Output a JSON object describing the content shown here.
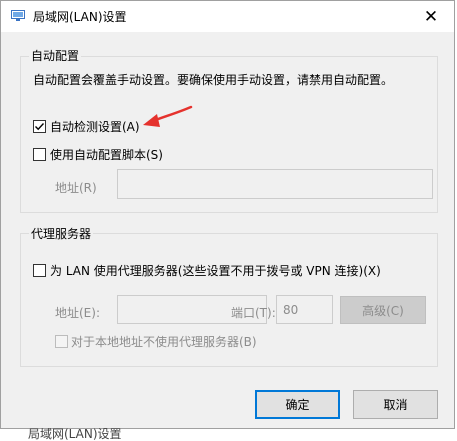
{
  "window": {
    "title": "局域网(LAN)设置",
    "close_glyph": "✕",
    "background_title": "局域网(LAN)设置"
  },
  "auto_config": {
    "group_label": "自动配置",
    "description": "自动配置会覆盖手动设置。要确保使用手动设置，请禁用自动配置。",
    "auto_detect": {
      "label": "自动检测设置(A)",
      "checked": true
    },
    "use_script": {
      "label": "使用自动配置脚本(S)",
      "checked": false
    },
    "address_label": "地址(R)",
    "address_value": ""
  },
  "proxy": {
    "group_label": "代理服务器",
    "use_proxy": {
      "label": "为 LAN 使用代理服务器(这些设置不用于拨号或 VPN 连接)(X)",
      "checked": false
    },
    "address_label": "地址(E):",
    "address_value": "",
    "port_label": "端口(T):",
    "port_value": "80",
    "advanced_label": "高级(C)",
    "bypass_local": {
      "label": "对于本地地址不使用代理服务器(B)",
      "checked": false
    }
  },
  "footer": {
    "ok_label": "确定",
    "cancel_label": "取消"
  },
  "colors": {
    "accent": "#0078d7",
    "annotation_arrow": "#e5322d"
  }
}
